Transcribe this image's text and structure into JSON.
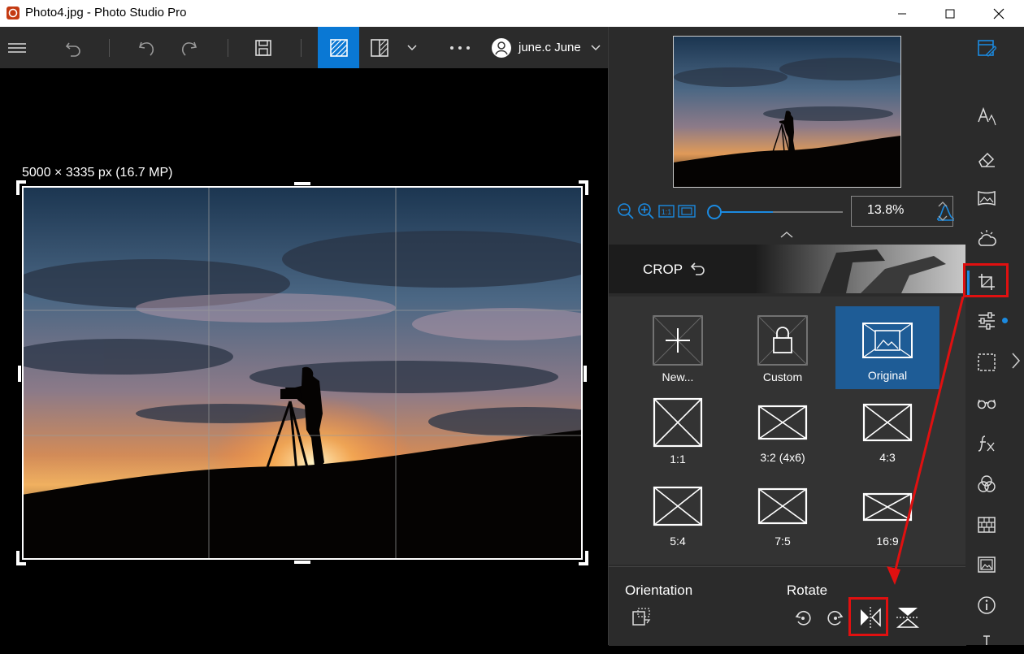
{
  "window": {
    "title": "Photo4.jpg - Photo Studio Pro"
  },
  "toolbar": {
    "user_label": "june.c June"
  },
  "canvas": {
    "image_dims": "5000 × 3335 px (16.7 MP)"
  },
  "navigator": {
    "zoom_value": "13.8%",
    "zoom_slider_fraction": 0.0
  },
  "crop": {
    "header_label": "CROP",
    "presets": [
      {
        "label": "New..."
      },
      {
        "label": "Custom"
      },
      {
        "label": "Original",
        "selected": true
      },
      {
        "label": "1:1"
      },
      {
        "label": "3:2 (4x6)"
      },
      {
        "label": "4:3"
      },
      {
        "label": "5:4"
      },
      {
        "label": "7:5"
      },
      {
        "label": "16:9"
      }
    ]
  },
  "orientation": {
    "orientation_label": "Orientation",
    "rotate_label": "Rotate"
  },
  "colors": {
    "accent": "#0a78d4",
    "selected_tile": "#1e5c96",
    "highlight": "#e01010"
  }
}
